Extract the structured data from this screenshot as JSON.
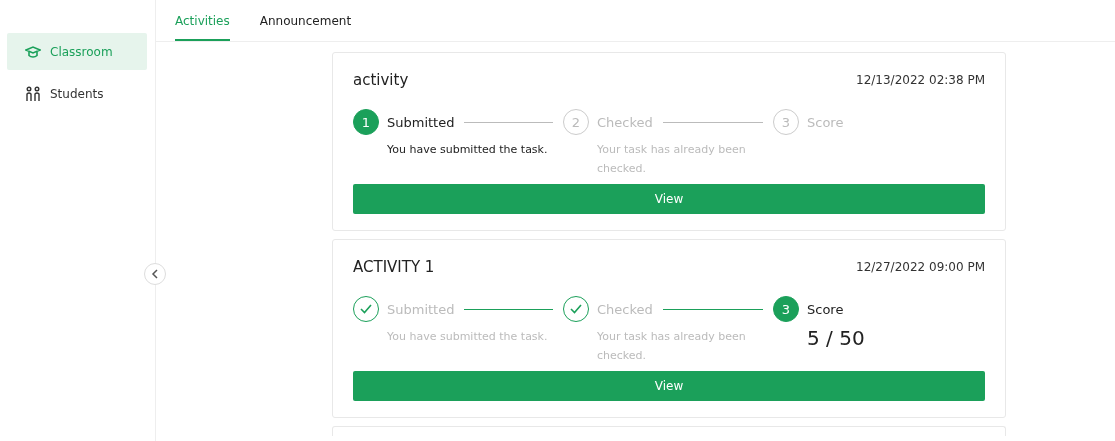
{
  "sidebar": {
    "items": [
      {
        "label": "Classroom",
        "selected": true
      },
      {
        "label": "Students",
        "selected": false
      }
    ]
  },
  "tabs": [
    {
      "label": "Activities",
      "selected": true
    },
    {
      "label": "Announcement",
      "selected": false
    }
  ],
  "activities": [
    {
      "title": "activity",
      "date": "12/13/2022 02:38 PM",
      "button": "View",
      "steps": [
        {
          "number": "1",
          "label": "Submitted",
          "active": true,
          "completed": false,
          "description": "You have submitted the task."
        },
        {
          "number": "2",
          "label": "Checked",
          "active": false,
          "completed": false,
          "description": "Your task has already been checked."
        },
        {
          "number": "3",
          "label": "Score",
          "active": false,
          "completed": false
        }
      ]
    },
    {
      "title": "ACTIVITY 1",
      "date": "12/27/2022 09:00 PM",
      "button": "View",
      "steps": [
        {
          "label": "Submitted",
          "active": false,
          "completed": true,
          "description": "You have submitted the task."
        },
        {
          "label": "Checked",
          "active": false,
          "completed": true,
          "description": "Your task has already been checked."
        },
        {
          "number": "3",
          "label": "Score",
          "active": true,
          "completed": false,
          "value": "5 / 50"
        }
      ]
    }
  ]
}
